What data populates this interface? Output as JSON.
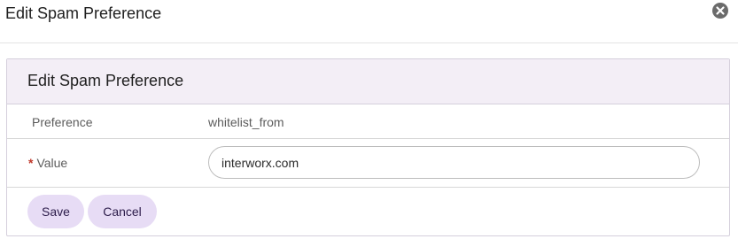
{
  "dialog": {
    "title": "Edit Spam Preference",
    "close_icon": "close-circle-icon"
  },
  "panel": {
    "title": "Edit Spam Preference",
    "preference_label": "Preference",
    "preference_value": "whitelist_from",
    "required_marker": "*",
    "value_label": "Value",
    "value_input": "interworx.com"
  },
  "actions": {
    "save_label": "Save",
    "cancel_label": "Cancel"
  },
  "colors": {
    "panel_header_bg": "#f3eef6",
    "button_bg": "#e7dcf5",
    "required": "#c0392b"
  }
}
